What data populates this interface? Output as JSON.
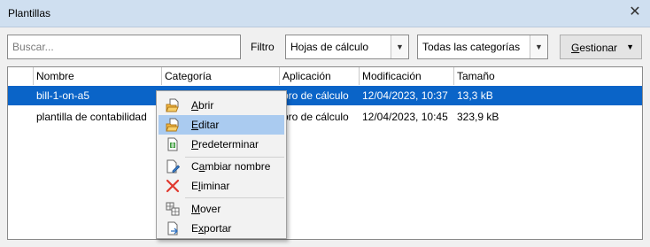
{
  "window": {
    "title": "Plantillas",
    "close_glyph": "✕"
  },
  "toolbar": {
    "search_placeholder": "Buscar...",
    "filter_label": "Filtro",
    "filter_value": "Hojas de cálculo",
    "category_value": "Todas las categorías",
    "manage_label_mnemonic": "G",
    "manage_label_rest": "estionar",
    "dropdown_glyph": "▼"
  },
  "table": {
    "columns": [
      "Nombre",
      "Categoría",
      "Aplicación",
      "Modificación",
      "Tamaño"
    ],
    "rows": [
      {
        "name": "bill-1-on-a5",
        "application": "bro de cálculo",
        "modified": "12/04/2023, 10:37",
        "size": "13,3 kB",
        "selected": true
      },
      {
        "name": "plantilla de contabilidad",
        "application": "bro de cálculo",
        "modified": "12/04/2023, 10:45",
        "size": "323,9 kB",
        "selected": false
      }
    ]
  },
  "context_menu": {
    "items": [
      {
        "mnemonic": "A",
        "rest": "brir",
        "icon": "open-folder-icon"
      },
      {
        "mnemonic": "E",
        "rest": "ditar",
        "icon": "edit-document-icon",
        "hover": true
      },
      {
        "mnemonic": "P",
        "rest": "redeterminar",
        "icon": "set-default-icon"
      },
      {
        "pre": "C",
        "mnemonic": "a",
        "rest": "mbiar nombre",
        "icon": "rename-icon"
      },
      {
        "pre": "E",
        "mnemonic": "l",
        "rest": "iminar",
        "icon": "delete-icon"
      },
      {
        "mnemonic": "M",
        "rest": "over",
        "icon": "move-icon"
      },
      {
        "pre": "E",
        "mnemonic": "x",
        "rest": "portar",
        "icon": "export-icon"
      }
    ]
  },
  "colors": {
    "titlebar": "#cfdff0",
    "selection": "#0a64c8",
    "menu_hover": "#aacbf0",
    "delete_icon": "#e0382e"
  }
}
